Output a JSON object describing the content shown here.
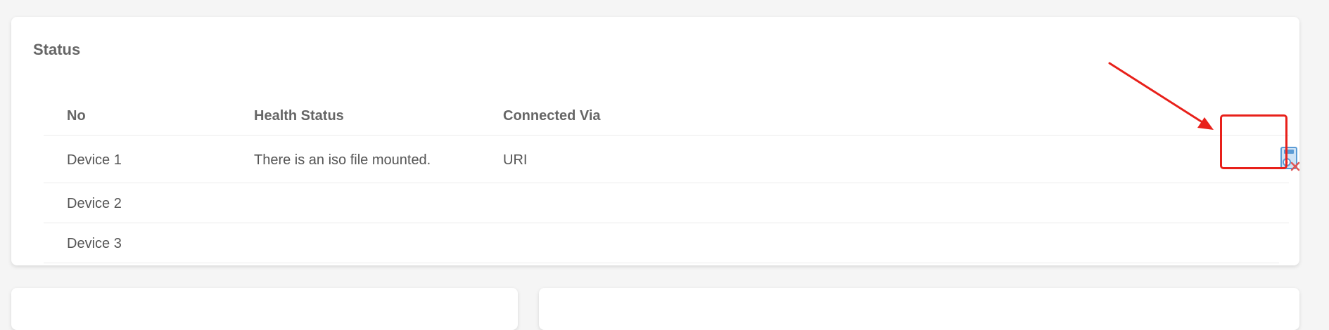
{
  "status_panel": {
    "title": "Status",
    "columns": {
      "no": "No",
      "health_status": "Health Status",
      "connected_via": "Connected Via"
    },
    "rows": [
      {
        "no": "Device 1",
        "health_status": "There is an iso file mounted.",
        "connected_via": "URI",
        "action_icon": "unmount-iso-icon"
      },
      {
        "no": "Device 2",
        "health_status": "",
        "connected_via": ""
      },
      {
        "no": "Device 3",
        "health_status": "",
        "connected_via": ""
      }
    ]
  },
  "annotation": {
    "color": "#e8201a"
  },
  "colors": {
    "page_background": "#f5f5f5",
    "card_background": "#ffffff",
    "icon_blue": "#5b9bd5",
    "icon_x": "#e05555"
  }
}
